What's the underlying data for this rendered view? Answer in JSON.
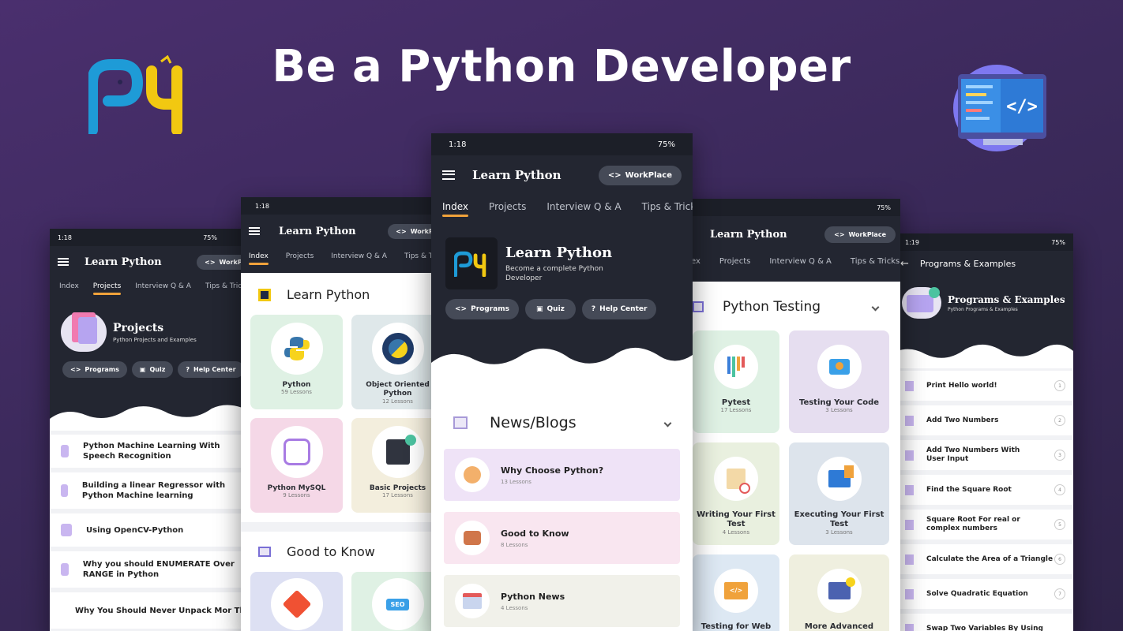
{
  "headline": "Be a Python Developer",
  "status": {
    "time": "1:18",
    "time_right": "1:19",
    "battery": "75%"
  },
  "app_title": "Learn Python",
  "workplace": "WorkPlace",
  "workplace_short": "WorkPla",
  "tabs": {
    "index": "Index",
    "index_cut": "ex",
    "projects": "Projects",
    "interview": "Interview Q & A",
    "tips": "Tips & Tricks",
    "tips_cut": "Tips & Tri"
  },
  "actions": {
    "programs": "Programs",
    "quiz": "Quiz",
    "help": "Help Center"
  },
  "phone1": {
    "header_title": "Projects",
    "header_sub": "Python Projects and Examples",
    "items": [
      "Python Machine Learning With Speech Recognition",
      "Building a linear Regressor with Python Machine learning",
      "Using OpenCV-Python",
      "Why you should ENUMERATE Over RANGE in Python",
      "Why You Should Never Unpack Mor Than Three Variables"
    ]
  },
  "phone2": {
    "section1": "Learn Python",
    "section2": "Good to Know",
    "cards": [
      {
        "title": "Python",
        "sub": "59 Lessons"
      },
      {
        "title": "Object Oriented Python",
        "sub": "12 Lessons"
      },
      {
        "title": "Python MySQL",
        "sub": "9 Lessons"
      },
      {
        "title": "Basic Projects",
        "sub": "17 Lessons"
      }
    ]
  },
  "phone3": {
    "hero_title": "Learn Python",
    "hero_sub": "Become a complete Python Developer",
    "section": "News/Blogs",
    "news": [
      {
        "title": "Why Choose Python?",
        "sub": "13 Lessons",
        "color": "#efe3f7"
      },
      {
        "title": "Good to Know",
        "sub": "8 Lessons",
        "color": "#f9e6f0"
      },
      {
        "title": "Python News",
        "sub": "4 Lessons",
        "color": "#f1f1ea"
      }
    ]
  },
  "phone4": {
    "section": "Python Testing",
    "cards": [
      {
        "title": "Pytest",
        "sub": "17 Lessons",
        "color": "#dff1e4"
      },
      {
        "title": "Testing Your Code",
        "sub": "3 Lessons",
        "color": "#e6def0"
      },
      {
        "title": "Writing Your First Test",
        "sub": "4 Lessons",
        "color": "#e9f0df"
      },
      {
        "title": "Executing Your First Test",
        "sub": "3 Lessons",
        "color": "#dde4ec"
      },
      {
        "title": "Testing for Web",
        "sub": "",
        "color": "#dde8f3"
      },
      {
        "title": "More Advanced",
        "sub": "",
        "color": "#efefdf"
      }
    ]
  },
  "phone5": {
    "bar_title": "Programs & Examples",
    "header_title": "Programs & Examples",
    "header_sub": "Python Programs & Examples",
    "items": [
      {
        "text": "Print Hello world!",
        "n": "1"
      },
      {
        "text": "Add Two Numbers",
        "n": "2"
      },
      {
        "text": "Add Two Numbers With User Input",
        "n": "3"
      },
      {
        "text": "Find the Square Root",
        "n": "4"
      },
      {
        "text": "Square Root For real or complex numbers",
        "n": "5"
      },
      {
        "text": "Calculate the Area of a Triangle",
        "n": "6"
      },
      {
        "text": "Solve Quadratic Equation",
        "n": "7"
      },
      {
        "text": "Swap Two Variables By Using",
        "n": ""
      }
    ]
  },
  "colors": {
    "accent": "#f0a23b",
    "dark": "#232631",
    "python_blue": "#3776ab",
    "python_yellow": "#f7d31c"
  }
}
